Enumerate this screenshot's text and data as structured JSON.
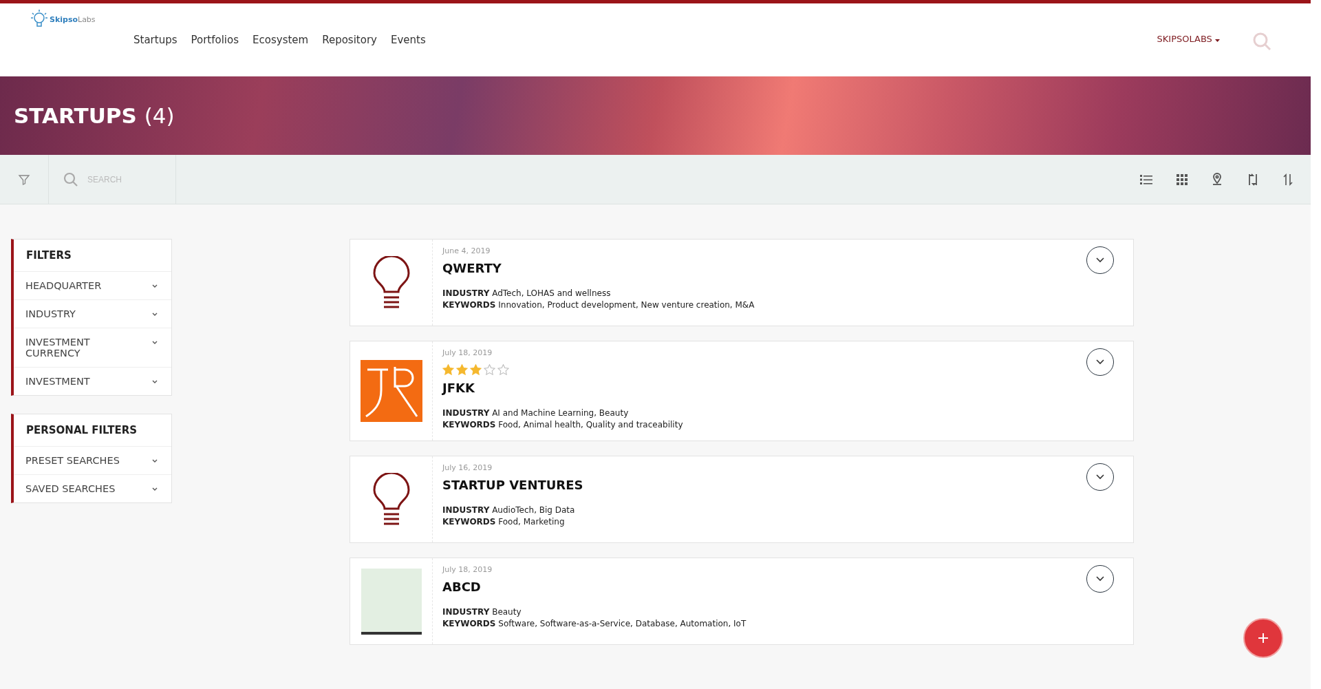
{
  "header": {
    "logo": {
      "brand_bold": "Skipso",
      "brand_light": "Labs"
    },
    "nav": [
      {
        "label": "Startups"
      },
      {
        "label": "Portfolios"
      },
      {
        "label": "Ecosystem"
      },
      {
        "label": "Repository"
      },
      {
        "label": "Events"
      }
    ],
    "account": "SKIPSOLABS"
  },
  "banner": {
    "title": "STARTUPS",
    "count": "(4)"
  },
  "toolbar": {
    "search": {
      "placeholder": "SEARCH"
    }
  },
  "sidebar": [
    {
      "title": "FILTERS",
      "items": [
        {
          "label": "HEADQUARTER"
        },
        {
          "label": "INDUSTRY"
        },
        {
          "label": "INVESTMENT CURRENCY"
        },
        {
          "label": "INVESTMENT"
        }
      ]
    },
    {
      "title": "PERSONAL FILTERS",
      "items": [
        {
          "label": "PRESET SEARCHES"
        },
        {
          "label": "SAVED SEARCHES"
        }
      ]
    }
  ],
  "startups": [
    {
      "kind": "bulb",
      "date": "June 4, 2019",
      "name": "QWERTY",
      "industry_label": "INDUSTRY",
      "industry": "AdTech, LOHAS and wellness",
      "keywords_label": "KEYWORDS",
      "keywords": "Innovation, Product development, New venture creation, M&A"
    },
    {
      "kind": "monogram",
      "date": "July 18, 2019",
      "stars": 3,
      "name": "JFKK",
      "industry_label": "INDUSTRY",
      "industry": "AI and Machine Learning, Beauty",
      "keywords_label": "KEYWORDS",
      "keywords": "Food, Animal health, Quality and traceability"
    },
    {
      "kind": "bulb",
      "date": "July 16, 2019",
      "name": "STARTUP VENTURES",
      "industry_label": "INDUSTRY",
      "industry": "AudioTech, Big Data",
      "keywords_label": "KEYWORDS",
      "keywords": "Food, Marketing"
    },
    {
      "kind": "picture",
      "date": "July 18, 2019",
      "name": "ABCD",
      "industry_label": "INDUSTRY",
      "industry": "Beauty",
      "keywords_label": "KEYWORDS",
      "keywords": "Software, Software-as-a-Service, Database, Automation, IoT"
    }
  ]
}
